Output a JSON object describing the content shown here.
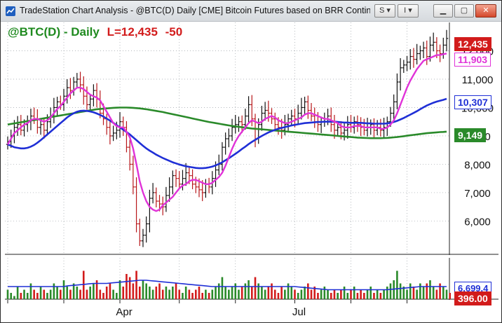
{
  "window": {
    "title": "TradeStation Chart Analysis - @BTC(D) Daily [CME] Bitcoin Futures based on BRR Continuo...",
    "buttons": {
      "symbol_link": "S",
      "indicator": "I"
    }
  },
  "header": {
    "symbol_label": "@BTC(D) - Daily",
    "last_label": "L=12,435",
    "change_label": "-50"
  },
  "price_axis": {
    "ticks": [
      "12,000",
      "11,000",
      "10,000",
      "9,000",
      "8,000",
      "7,000",
      "6,000"
    ],
    "tick_values": [
      12000,
      11000,
      10000,
      9000,
      8000,
      7000,
      6000
    ]
  },
  "price_tags": {
    "last": {
      "text": "12,435",
      "color": "#d21b1b"
    },
    "ma_short": {
      "text": "11,903",
      "color": "#e032d8"
    },
    "ma_mid": {
      "text": "10,307",
      "color": "#1f2fd6"
    },
    "ma_long": {
      "text": "9,149",
      "color": "#2a8a2a"
    }
  },
  "volume_axis": {
    "tag_avg": {
      "text": "6,699.4",
      "color": "#1f2fd6"
    },
    "tag_last": {
      "text": "396.00",
      "color": "#d21b1b"
    }
  },
  "time_axis": {
    "labels": [
      "Apr",
      "Jul"
    ]
  },
  "colors": {
    "up": "#2a8a2a",
    "down": "#d21b1b",
    "bar_body": "#111111"
  },
  "chart_data": {
    "type": "candlestick",
    "y_range": [
      4800,
      13000
    ],
    "series": [
      {
        "name": "",
        "values_ref": "closes"
      }
    ],
    "closes": [
      8800,
      9000,
      9300,
      9400,
      9200,
      9400,
      9500,
      9700,
      9600,
      9300,
      9400,
      9200,
      9500,
      9700,
      10000,
      10200,
      10100,
      10400,
      10700,
      10600,
      10900,
      11000,
      10800,
      10400,
      10100,
      10300,
      10600,
      10300,
      9800,
      9600,
      9300,
      9000,
      9100,
      9200,
      9500,
      9300,
      8600,
      8000,
      7200,
      5900,
      5300,
      5500,
      5900,
      6800,
      7000,
      6700,
      6600,
      6500,
      6900,
      7200,
      7600,
      7500,
      7300,
      7500,
      7700,
      7600,
      7300,
      7200,
      7100,
      7000,
      7300,
      7200,
      7500,
      7800,
      8000,
      8600,
      8900,
      9000,
      9300,
      9400,
      9500,
      9400,
      9700,
      10100,
      9600,
      8900,
      9400,
      9800,
      9900,
      9800,
      9600,
      9400,
      9300,
      9200,
      9400,
      9600,
      9700,
      9600,
      9800,
      10000,
      10200,
      9900,
      9700,
      9500,
      9400,
      9500,
      9600,
      9700,
      9400,
      9200,
      9300,
      9100,
      9200,
      9400,
      9300,
      9500,
      9400,
      9300,
      9200,
      9300,
      9400,
      9200,
      9300,
      9200,
      9300,
      9500,
      9800,
      10200,
      10900,
      11400,
      11500,
      11600,
      11800,
      11700,
      11900,
      12000,
      12100,
      11800,
      12200,
      12300,
      12000,
      11900,
      12200,
      12435
    ],
    "ma_short": [
      8700,
      8900,
      9100,
      9200,
      9300,
      9400,
      9450,
      9550,
      9600,
      9600,
      9550,
      9500,
      9550,
      9650,
      9800,
      9950,
      10050,
      10200,
      10350,
      10500,
      10600,
      10700,
      10700,
      10650,
      10550,
      10450,
      10400,
      10350,
      10250,
      10050,
      9850,
      9650,
      9450,
      9350,
      9300,
      9300,
      9150,
      8950,
      8550,
      8000,
      7400,
      7000,
      6700,
      6500,
      6400,
      6350,
      6400,
      6550,
      6650,
      6750,
      6850,
      7000,
      7150,
      7250,
      7300,
      7400,
      7450,
      7450,
      7400,
      7350,
      7300,
      7300,
      7350,
      7450,
      7550,
      7700,
      7950,
      8250,
      8550,
      8800,
      9000,
      9150,
      9300,
      9450,
      9550,
      9500,
      9450,
      9500,
      9600,
      9650,
      9700,
      9650,
      9550,
      9500,
      9450,
      9450,
      9500,
      9550,
      9600,
      9650,
      9750,
      9800,
      9800,
      9750,
      9700,
      9650,
      9600,
      9600,
      9550,
      9500,
      9450,
      9350,
      9300,
      9300,
      9300,
      9350,
      9350,
      9350,
      9300,
      9300,
      9300,
      9300,
      9300,
      9250,
      9250,
      9300,
      9400,
      9550,
      9800,
      10100,
      10400,
      10700,
      10950,
      11150,
      11350,
      11500,
      11650,
      11700,
      11750,
      11800,
      11850,
      11850,
      11880,
      11903
    ],
    "ma_mid": [
      8700,
      8650,
      8600,
      8580,
      8560,
      8560,
      8580,
      8620,
      8680,
      8760,
      8850,
      8950,
      9050,
      9150,
      9250,
      9350,
      9450,
      9550,
      9650,
      9730,
      9800,
      9850,
      9880,
      9890,
      9880,
      9860,
      9830,
      9790,
      9740,
      9680,
      9610,
      9540,
      9460,
      9380,
      9300,
      9220,
      9140,
      9050,
      8950,
      8850,
      8750,
      8650,
      8560,
      8480,
      8410,
      8340,
      8280,
      8220,
      8170,
      8120,
      8070,
      8030,
      7990,
      7960,
      7930,
      7910,
      7890,
      7870,
      7860,
      7860,
      7870,
      7890,
      7920,
      7960,
      8010,
      8070,
      8140,
      8210,
      8290,
      8370,
      8450,
      8540,
      8620,
      8710,
      8790,
      8860,
      8930,
      9000,
      9060,
      9120,
      9170,
      9210,
      9250,
      9280,
      9310,
      9340,
      9370,
      9390,
      9410,
      9430,
      9450,
      9460,
      9470,
      9480,
      9490,
      9490,
      9500,
      9500,
      9500,
      9500,
      9490,
      9480,
      9470,
      9470,
      9460,
      9460,
      9460,
      9460,
      9450,
      9440,
      9440,
      9430,
      9430,
      9430,
      9430,
      9440,
      9460,
      9490,
      9530,
      9580,
      9630,
      9690,
      9750,
      9810,
      9870,
      9940,
      10010,
      10070,
      10120,
      10170,
      10210,
      10240,
      10270,
      10307
    ],
    "ma_long": [
      9400,
      9420,
      9440,
      9460,
      9480,
      9500,
      9520,
      9540,
      9560,
      9580,
      9600,
      9620,
      9640,
      9660,
      9680,
      9700,
      9720,
      9740,
      9760,
      9780,
      9800,
      9820,
      9840,
      9860,
      9880,
      9900,
      9920,
      9940,
      9950,
      9960,
      9970,
      9980,
      9990,
      9995,
      10000,
      10000,
      10000,
      9995,
      9990,
      9980,
      9970,
      9955,
      9940,
      9920,
      9900,
      9880,
      9860,
      9840,
      9815,
      9790,
      9765,
      9740,
      9715,
      9690,
      9665,
      9640,
      9615,
      9590,
      9565,
      9540,
      9515,
      9490,
      9470,
      9450,
      9430,
      9410,
      9390,
      9370,
      9350,
      9335,
      9320,
      9305,
      9290,
      9275,
      9260,
      9250,
      9240,
      9230,
      9220,
      9210,
      9200,
      9190,
      9180,
      9170,
      9160,
      9150,
      9140,
      9130,
      9120,
      9110,
      9100,
      9090,
      9080,
      9070,
      9060,
      9050,
      9040,
      9030,
      9020,
      9010,
      9000,
      8990,
      8980,
      8970,
      8960,
      8950,
      8940,
      8935,
      8930,
      8925,
      8920,
      8920,
      8920,
      8920,
      8925,
      8930,
      8940,
      8950,
      8960,
      8975,
      8990,
      9005,
      9020,
      9035,
      9050,
      9065,
      9080,
      9095,
      9105,
      9115,
      9125,
      9135,
      9140,
      9149
    ],
    "volumes": [
      3,
      2,
      1,
      4,
      2,
      3,
      2,
      5,
      3,
      2,
      4,
      3,
      2,
      3,
      5,
      4,
      3,
      6,
      4,
      3,
      5,
      4,
      3,
      9,
      3,
      4,
      5,
      6,
      3,
      2,
      4,
      5,
      3,
      2,
      6,
      4,
      8,
      7,
      5,
      9,
      4,
      6,
      5,
      4,
      3,
      4,
      5,
      3,
      4,
      3,
      4,
      5,
      3,
      2,
      4,
      3,
      2,
      3,
      4,
      2,
      3,
      2,
      3,
      4,
      5,
      7,
      4,
      3,
      4,
      5,
      3,
      4,
      5,
      6,
      4,
      7,
      5,
      4,
      3,
      4,
      5,
      3,
      2,
      4,
      3,
      5,
      4,
      3,
      2,
      3,
      4,
      5,
      3,
      4,
      2,
      3,
      4,
      3,
      2,
      3,
      2,
      3,
      4,
      2,
      3,
      4,
      2,
      3,
      2,
      3,
      4,
      2,
      3,
      2,
      3,
      4,
      5,
      6,
      9,
      5,
      4,
      3,
      5,
      4,
      3,
      5,
      4,
      5,
      6,
      4,
      3,
      5,
      4,
      3,
      2
    ],
    "volume_avg": [
      4,
      4,
      4,
      4,
      4,
      4,
      4,
      4,
      4,
      4,
      4,
      4,
      4,
      4,
      4,
      4,
      4,
      4,
      4.2,
      4.3,
      4.4,
      4.5,
      4.6,
      4.7,
      4.8,
      4.9,
      5,
      5,
      5,
      5,
      5,
      5.1,
      5.2,
      5.3,
      5.4,
      5.5,
      5.6,
      5.7,
      5.8,
      5.9,
      6,
      6,
      6,
      5.9,
      5.8,
      5.7,
      5.6,
      5.5,
      5.4,
      5.3,
      5.2,
      5.1,
      5,
      4.9,
      4.8,
      4.7,
      4.6,
      4.5,
      4.4,
      4.3,
      4.2,
      4.1,
      4,
      4,
      4,
      4,
      4,
      4,
      4,
      4,
      4,
      4,
      4,
      4,
      4,
      4,
      4,
      4,
      4,
      4,
      4,
      4,
      4,
      4,
      4,
      4,
      4,
      4,
      3.9,
      3.8,
      3.7,
      3.6,
      3.5,
      3.4,
      3.3,
      3.2,
      3.1,
      3,
      3,
      3,
      3,
      3,
      3,
      3,
      3,
      3,
      3,
      3,
      3,
      3,
      3,
      3,
      3,
      3,
      3,
      3,
      3.1,
      3.2,
      3.3,
      3.4,
      3.5,
      3.6,
      3.7,
      3.8,
      3.9,
      4,
      4,
      4,
      4,
      4,
      4,
      4,
      4,
      4
    ]
  }
}
